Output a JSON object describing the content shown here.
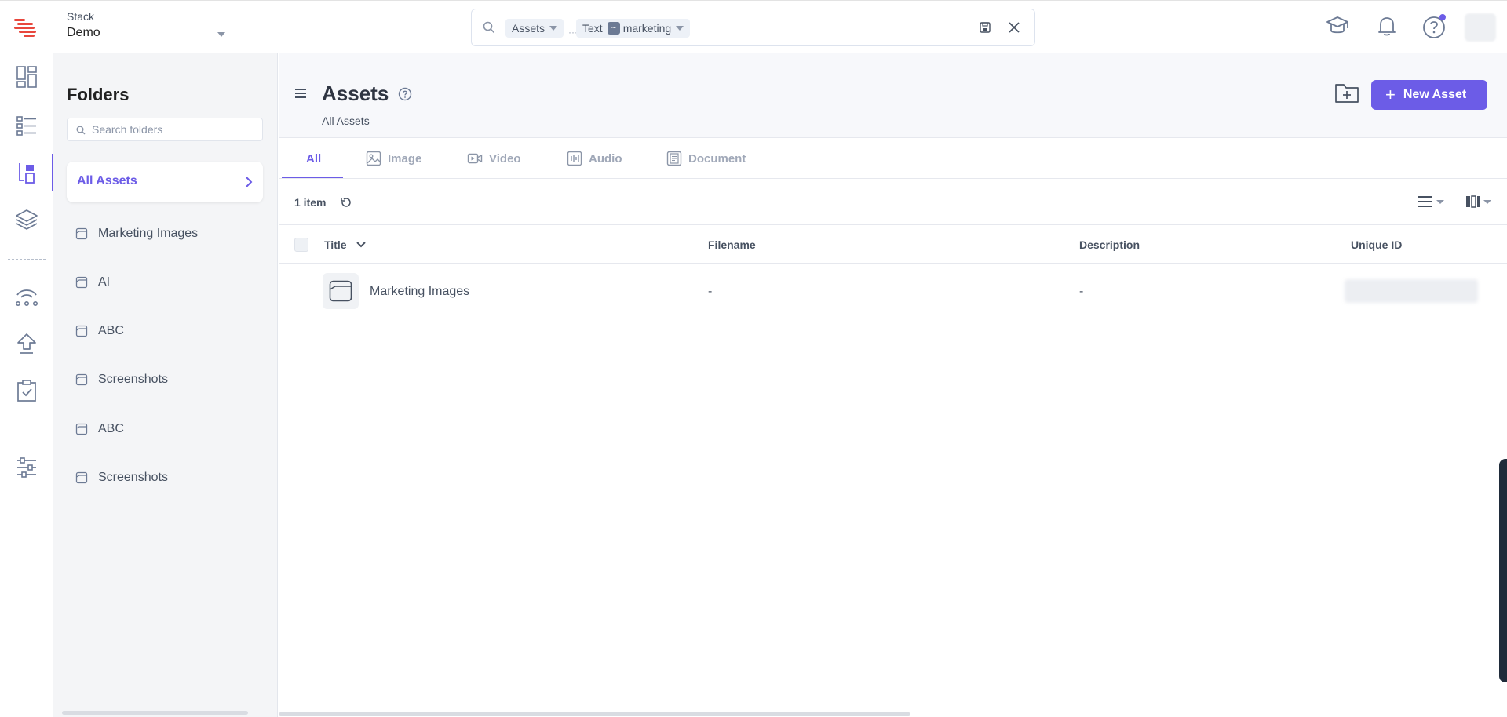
{
  "stack": {
    "label": "Stack",
    "name": "Demo"
  },
  "search": {
    "chip_module": "Assets",
    "chip_field": "Text",
    "chip_operator": "~",
    "chip_value": "marketing",
    "ellipsis": "···"
  },
  "folders": {
    "title": "Folders",
    "search_placeholder": "Search folders",
    "all_assets_label": "All Assets",
    "items": [
      {
        "label": "Marketing Images"
      },
      {
        "label": "AI"
      },
      {
        "label": "ABC"
      },
      {
        "label": "Screenshots"
      },
      {
        "label": "ABC"
      },
      {
        "label": "Screenshots"
      }
    ]
  },
  "header": {
    "title": "Assets",
    "breadcrumb": "All Assets",
    "new_asset_label": "New Asset"
  },
  "tabs": [
    {
      "label": "All",
      "icon": "none",
      "active": true
    },
    {
      "label": "Image",
      "icon": "image-icon"
    },
    {
      "label": "Video",
      "icon": "video-icon"
    },
    {
      "label": "Audio",
      "icon": "audio-icon"
    },
    {
      "label": "Document",
      "icon": "document-icon"
    }
  ],
  "toolbar": {
    "item_count": "1 item"
  },
  "table": {
    "columns": [
      "Title",
      "Filename",
      "Description",
      "Unique ID"
    ],
    "rows": [
      {
        "title": "Marketing Images",
        "filename": "-",
        "description": "-"
      }
    ]
  },
  "colors": {
    "accent": "#6c5ce7",
    "text": "#475161",
    "brand": "#e8473d"
  }
}
